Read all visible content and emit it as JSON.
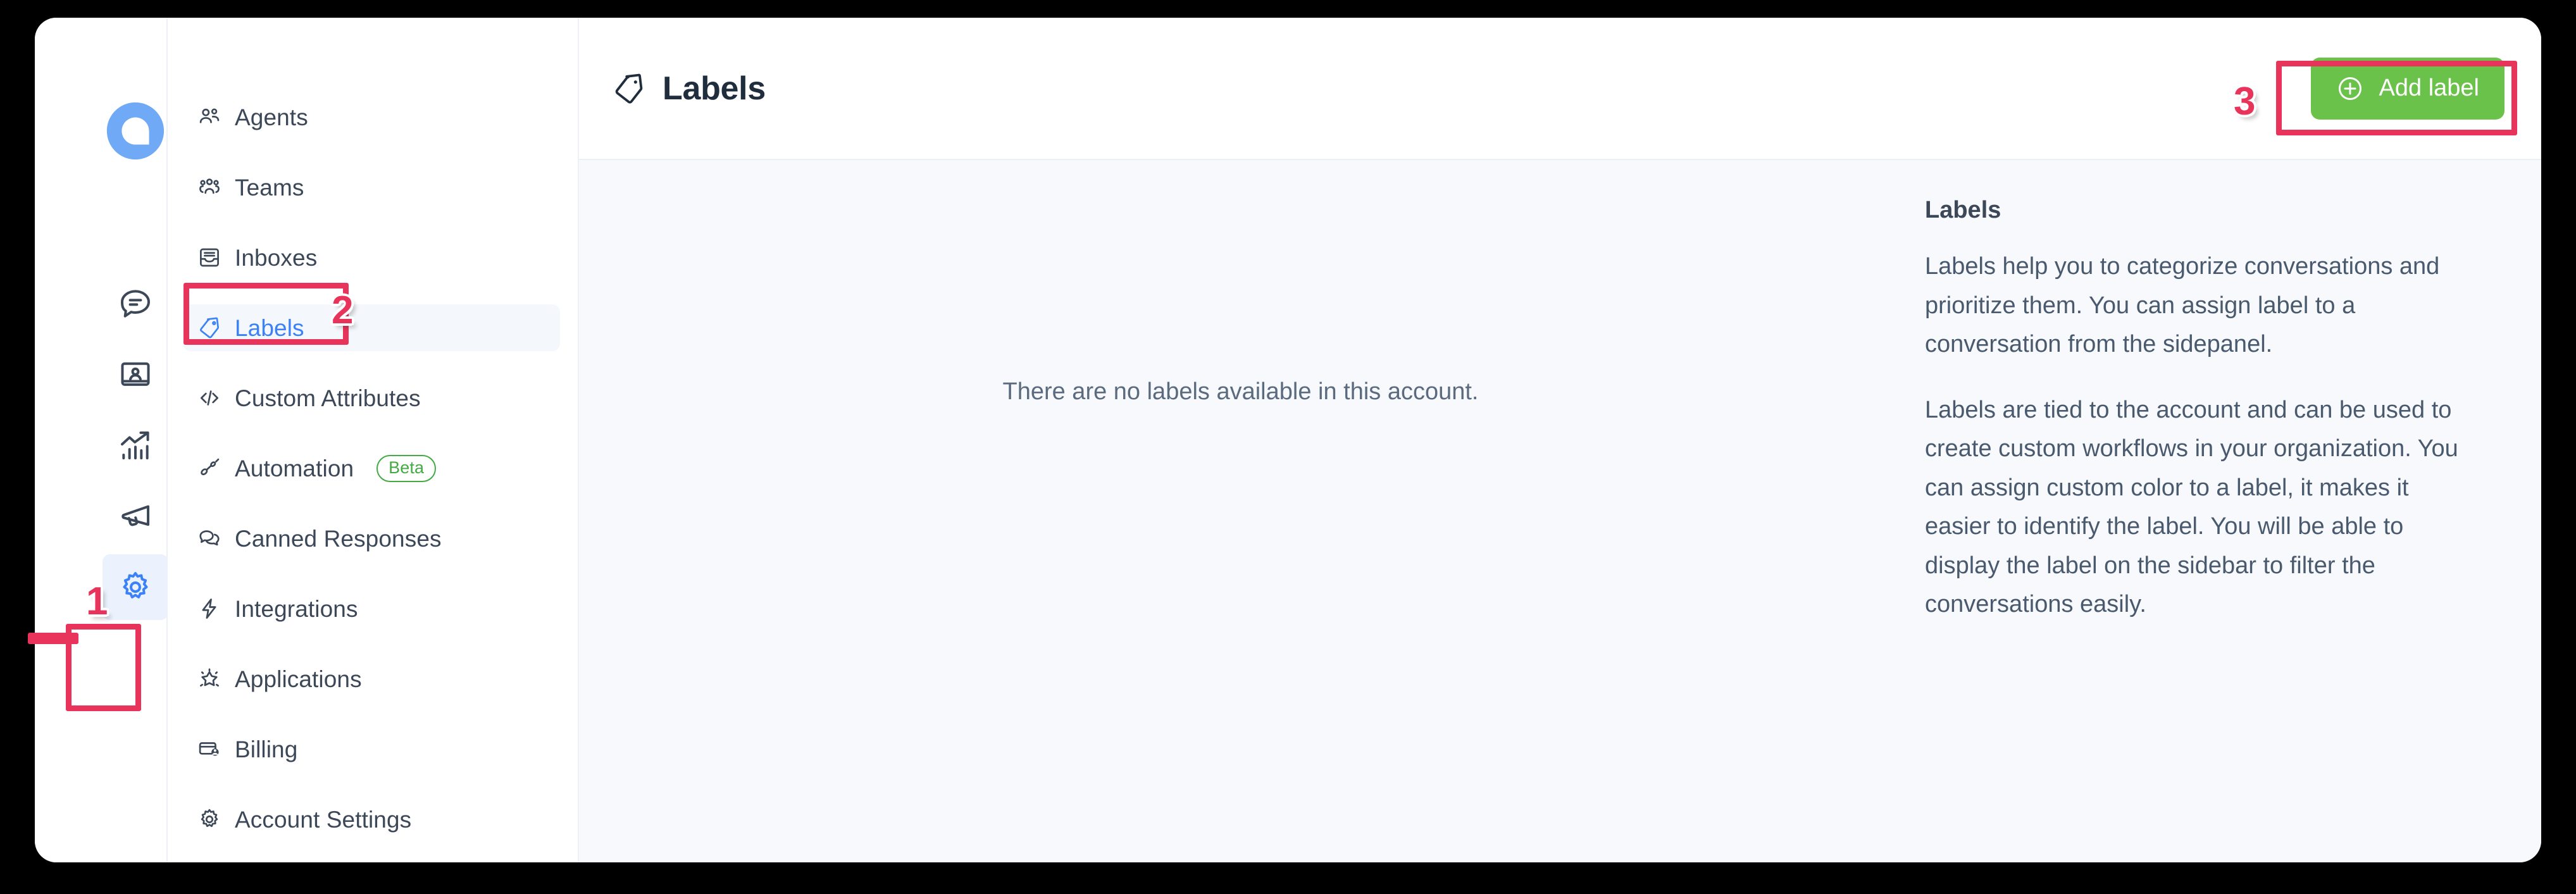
{
  "primary_rail": {
    "logo_icon": "chatwoot-logo-icon",
    "items": [
      {
        "icon": "conversations-chat-icon",
        "name": "conversations",
        "active": false
      },
      {
        "icon": "contacts-book-icon",
        "name": "contacts",
        "active": false
      },
      {
        "icon": "reports-chart-icon",
        "name": "reports",
        "active": false
      },
      {
        "icon": "campaigns-megaphone-icon",
        "name": "campaigns",
        "active": false
      },
      {
        "icon": "settings-gear-icon",
        "name": "settings",
        "active": true
      }
    ]
  },
  "settings_menu": {
    "items": [
      {
        "label": "Agents",
        "icon": "agents-icon",
        "active": false
      },
      {
        "label": "Teams",
        "icon": "teams-icon",
        "active": false
      },
      {
        "label": "Inboxes",
        "icon": "inboxes-icon",
        "active": false
      },
      {
        "label": "Labels",
        "icon": "label-tag-icon",
        "active": true
      },
      {
        "label": "Custom Attributes",
        "icon": "code-brackets-icon",
        "active": false
      },
      {
        "label": "Automation",
        "icon": "automation-icon",
        "active": false,
        "badge": "Beta"
      },
      {
        "label": "Canned Responses",
        "icon": "canned-responses-icon",
        "active": false
      },
      {
        "label": "Integrations",
        "icon": "integrations-bolt-icon",
        "active": false
      },
      {
        "label": "Applications",
        "icon": "applications-star-icon",
        "active": false
      },
      {
        "label": "Billing",
        "icon": "billing-card-icon",
        "active": false
      },
      {
        "label": "Account Settings",
        "icon": "account-gear-icon",
        "active": false
      }
    ]
  },
  "header": {
    "title": "Labels",
    "title_icon": "label-tag-icon",
    "add_button_label": "Add label",
    "add_button_icon": "plus-circle-icon",
    "add_button_color": "#6bc24a"
  },
  "main": {
    "empty_state_text": "There are no labels available in this account."
  },
  "info_pane": {
    "title": "Labels",
    "paragraph_1": "Labels help you to categorize conversations and prioritize them. You can assign label to a conversation from the sidepanel.",
    "paragraph_2": "Labels are tied to the account and can be used to create custom workflows in your organization. You can assign custom color to a label, it makes it easier to identify the label. You will be able to display the label on the sidebar to filter the conversations easily."
  },
  "annotations": {
    "color": "#e8345a",
    "steps": [
      {
        "number": "1",
        "target": "settings-gear-rail-icon"
      },
      {
        "number": "2",
        "target": "labels-menu-item"
      },
      {
        "number": "3",
        "target": "add-label-button"
      }
    ]
  }
}
